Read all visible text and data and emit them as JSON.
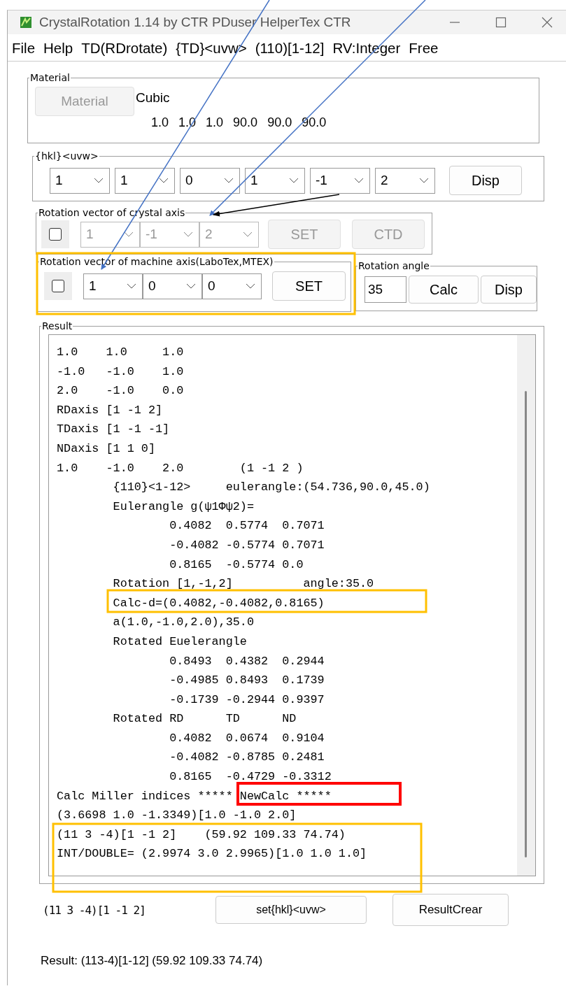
{
  "window": {
    "title": "CrystalRotation 1.14 by CTR PDuser HelperTex CTR"
  },
  "menu": [
    "File",
    "Help",
    "TD(RDrotate)",
    "{TD}<uvw>",
    "(110)[1-12]",
    "RV:Integer",
    "Free"
  ],
  "material": {
    "legend": "Material",
    "button": {
      "label": "Material",
      "disabled": true
    },
    "crystal": "Cubic",
    "params": [
      "1.0",
      "1.0",
      "1.0",
      "90.0",
      "90.0",
      "90.0"
    ]
  },
  "hkl": {
    "legend": "{hkl}<uvw>",
    "combos": [
      {
        "value": "1",
        "disabled": false
      },
      {
        "value": "1",
        "disabled": false
      },
      {
        "value": "0",
        "disabled": false
      },
      {
        "value": "1",
        "disabled": false
      },
      {
        "value": "-1",
        "disabled": false
      },
      {
        "value": "2",
        "disabled": false
      }
    ],
    "button": {
      "label": "Disp",
      "disabled": false
    }
  },
  "crystal_axis": {
    "legend": "Rotation vector of crystal axis",
    "checkbox": {
      "checked": false
    },
    "combos": [
      {
        "value": "1",
        "disabled": true
      },
      {
        "value": "-1",
        "disabled": true
      },
      {
        "value": "2",
        "disabled": true
      }
    ],
    "buttons": [
      {
        "label": "SET",
        "disabled": true
      },
      {
        "label": "CTD",
        "disabled": true
      }
    ]
  },
  "machine_axis": {
    "legend": "Rotation vector of machine axis(LaboTex,MTEX)",
    "checkbox": {
      "checked": false
    },
    "combos": [
      {
        "value": "1",
        "disabled": false
      },
      {
        "value": "0",
        "disabled": false
      },
      {
        "value": "0",
        "disabled": false
      }
    ],
    "button": {
      "label": "SET",
      "disabled": false
    }
  },
  "rotation_angle": {
    "legend": "Rotation angle",
    "value": "35",
    "buttons": [
      "Calc",
      "Disp"
    ]
  },
  "result": {
    "legend": "Result",
    "lines": [
      "1.0    1.0     1.0",
      "-1.0   -1.0    1.0",
      "2.0    -1.0    0.0",
      "RDaxis [1 -1 2]",
      "TDaxis [1 -1 -1]",
      "NDaxis [1 1 0]",
      "1.0    -1.0    2.0        (1 -1 2 )",
      "        {110}<1-12>     eulerangle:(54.736,90.0,45.0)",
      "        Eulerangle g(ψ1Φψ2)=",
      "                0.4082  0.5774  0.7071",
      "                -0.4082 -0.5774 0.7071",
      "                0.8165  -0.5774 0.0",
      "        Rotation [1,-1,2]          angle:35.0",
      "        Calc-d=(0.4082,-0.4082,0.8165)",
      "        a(1.0,-1.0,2.0),35.0",
      "        Rotated Euelerangle",
      "                0.8493  0.4382  0.2944",
      "                -0.4985 0.8493  0.1739",
      "                -0.1739 -0.2944 0.9397",
      "        Rotated RD      TD      ND",
      "                0.4082  0.0674  0.9104",
      "                -0.4082 -0.8785 0.2481",
      "                0.8165  -0.4729 -0.3312",
      "Calc Miller indices ***** NewCalc *****",
      "(3.6698 1.0 -1.3349)[1.0 -1.0 2.0]",
      "(11 3 -4)[1 -1 2]    (59.92 109.33 74.74)",
      "INT/DOUBLE= (2.9974 3.0 2.9965)[1.0 1.0 1.0]"
    ]
  },
  "footer": {
    "indices": "(11 3 -4)[1 -1 2]",
    "buttons": [
      "set{hkl}<uvw>",
      "ResultCrear"
    ],
    "result_text": "Result: (113-4)[1-12] (59.92 109.33 74.74)"
  }
}
